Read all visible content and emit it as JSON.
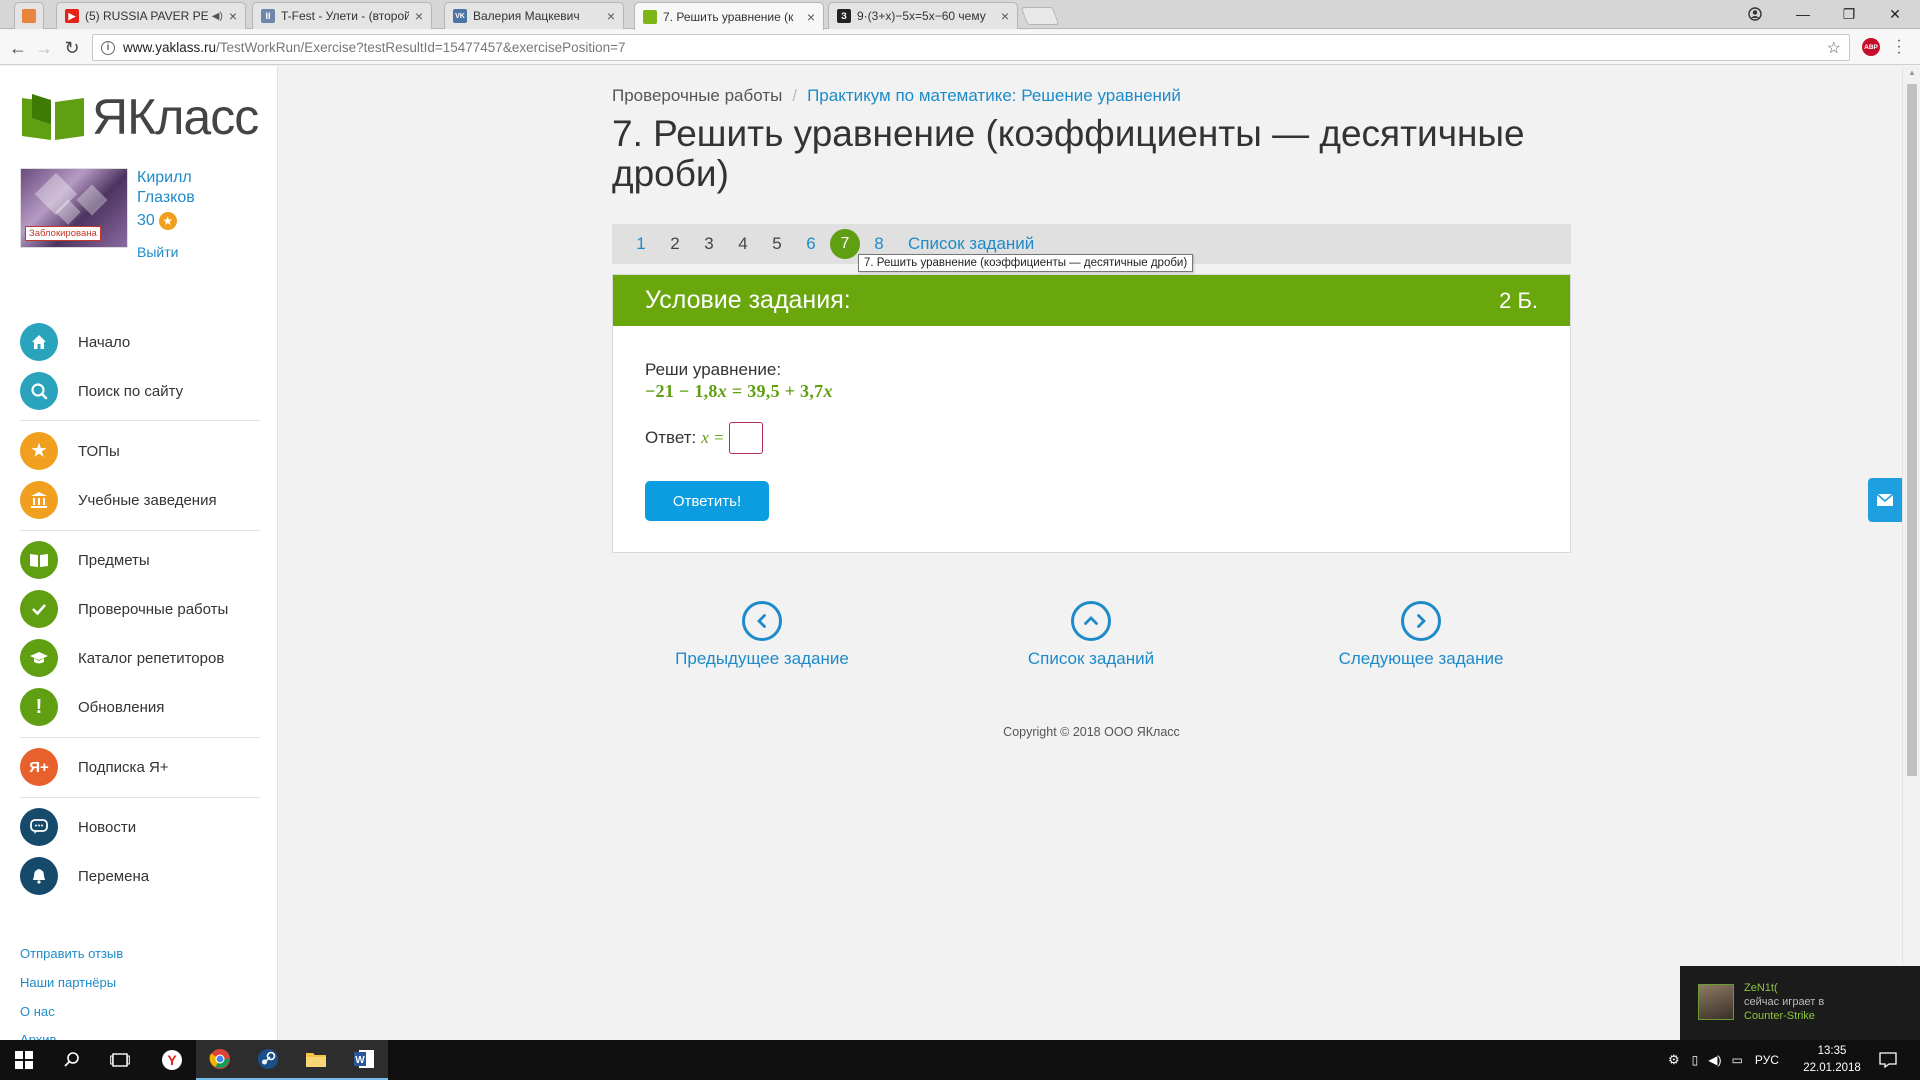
{
  "browser": {
    "tabs": [
      {
        "label": "",
        "favicon_color": "#e8843c",
        "favicon_text": ""
      },
      {
        "label": "(5) RUSSIA PAVER РЕ",
        "favicon_color": "#e62117",
        "favicon_text": "▶"
      },
      {
        "label": "T-Fest - Улети - (второй",
        "favicon_color": "#6d86a9",
        "favicon_text": "II"
      },
      {
        "label": "Валерия Мацкевич",
        "favicon_color": "#4c75a3",
        "favicon_text": "VK"
      },
      {
        "label": "7. Решить уравнение (к",
        "favicon_color": "#7cb518",
        "favicon_text": ""
      },
      {
        "label": "9·(3+x)−5x=5x−60 чему",
        "favicon_color": "#222222",
        "favicon_text": "З"
      }
    ],
    "url_main": "www.yaklass.ru",
    "url_rest": "/TestWorkRun/Exercise?testResultId=15477457&exercisePosition=7"
  },
  "sidebar": {
    "logo_text": "ЯКласс",
    "user": {
      "first_name": "Кирилл",
      "last_name": "Глазков",
      "score": "30",
      "blocked_label": "Заблокирована",
      "logout": "Выйти"
    },
    "nav": [
      {
        "label": "Начало",
        "icon": "home-icon",
        "color": "#2aa3bd"
      },
      {
        "label": "Поиск по сайту",
        "icon": "search-icon",
        "color": "#2aa3bd"
      },
      {
        "label": "ТОПы",
        "icon": "star-icon",
        "color": "#f0a01e"
      },
      {
        "label": "Учебные заведения",
        "icon": "school-icon",
        "color": "#f0a01e"
      },
      {
        "label": "Предметы",
        "icon": "books-icon",
        "color": "#5f9f11"
      },
      {
        "label": "Проверочные работы",
        "icon": "check-icon",
        "color": "#5f9f11"
      },
      {
        "label": "Каталог репетиторов",
        "icon": "graduation-cap-icon",
        "color": "#5f9f11"
      },
      {
        "label": "Обновления",
        "icon": "exclamation-icon",
        "color": "#5f9f11"
      },
      {
        "label": "Подписка Я+",
        "icon": "plus-subscription-icon",
        "color": "#e8612c"
      },
      {
        "label": "Новости",
        "icon": "chat-icon",
        "color": "#164a6b"
      },
      {
        "label": "Перемена",
        "icon": "bell-icon",
        "color": "#164a6b"
      }
    ],
    "footer_links": [
      "Отправить отзыв",
      "Наши партнёры",
      "О нас",
      "Архив"
    ]
  },
  "main": {
    "breadcrumb": {
      "root": "Проверочные работы",
      "separator": "/",
      "current": "Практикум по математике: Решение уравнений"
    },
    "title": "7. Решить уравнение (коэффициенты — десятичные дроби)",
    "pager": {
      "done": [
        "1",
        "6",
        "8"
      ],
      "items": [
        "1",
        "2",
        "3",
        "4",
        "5",
        "6",
        "7",
        "8"
      ],
      "current": "7",
      "list_label": "Список заданий",
      "tooltip": "7. Решить уравнение (коэффициенты — десятичные дроби)"
    },
    "task": {
      "header": "Условие задания:",
      "score": "2 Б.",
      "prompt": "Реши уравнение:",
      "equation": "−21 − 1,8x = 39,5 + 3,7x",
      "answer_label": "Ответ:",
      "answer_var": "x =",
      "answer_value": "",
      "submit": "Ответить!"
    },
    "bottom_nav": {
      "prev": "Предыдущее задание",
      "list": "Список заданий",
      "next": "Следующее задание"
    },
    "copyright": "Copyright © 2018 ООО ЯКласс"
  },
  "steam_notification": {
    "user": "ZeN1t(",
    "status": "сейчас играет в",
    "game": "Counter-Strike"
  },
  "taskbar": {
    "lang": "РУС",
    "time": "13:35",
    "date": "22.01.2018"
  }
}
